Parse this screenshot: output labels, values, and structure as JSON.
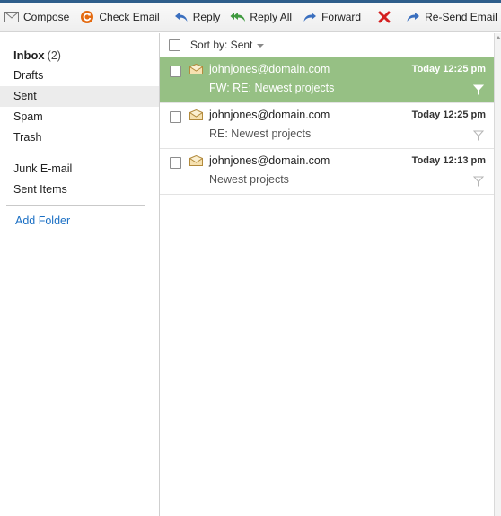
{
  "toolbar": {
    "compose": "Compose",
    "check_email": "Check Email",
    "reply": "Reply",
    "reply_all": "Reply All",
    "forward": "Forward",
    "resend": "Re-Send Email"
  },
  "sidebar": {
    "inbox_label": "Inbox",
    "inbox_count": "(2)",
    "folders": [
      "Drafts",
      "Sent",
      "Spam",
      "Trash"
    ],
    "extra_folders": [
      "Junk E-mail",
      "Sent Items"
    ],
    "add_folder": "Add Folder",
    "selected_folder": "Sent"
  },
  "list_header": {
    "sort_label": "Sort by: Sent"
  },
  "messages": [
    {
      "from": "johnjones@domain.com",
      "subject": "FW: RE: Newest projects",
      "date": "Today 12:25 pm",
      "selected": true
    },
    {
      "from": "johnjones@domain.com",
      "subject": "RE: Newest projects",
      "date": "Today 12:25 pm",
      "selected": false
    },
    {
      "from": "johnjones@domain.com",
      "subject": "Newest projects",
      "date": "Today 12:13 pm",
      "selected": false
    }
  ],
  "colors": {
    "selected_row": "#96c084",
    "link": "#1a6fc4",
    "delete": "#d42020",
    "arrow_blue": "#3a6fbf",
    "arrow_green": "#3f9a3f",
    "check_orange": "#e46a10"
  },
  "icons": {
    "compose": "envelope-icon",
    "check_email": "refresh-icon",
    "reply": "reply-arrow-icon",
    "reply_all": "reply-all-arrow-icon",
    "forward": "forward-arrow-icon",
    "delete": "delete-x-icon",
    "resend": "resend-arrow-icon",
    "folder": "folder-icon"
  }
}
